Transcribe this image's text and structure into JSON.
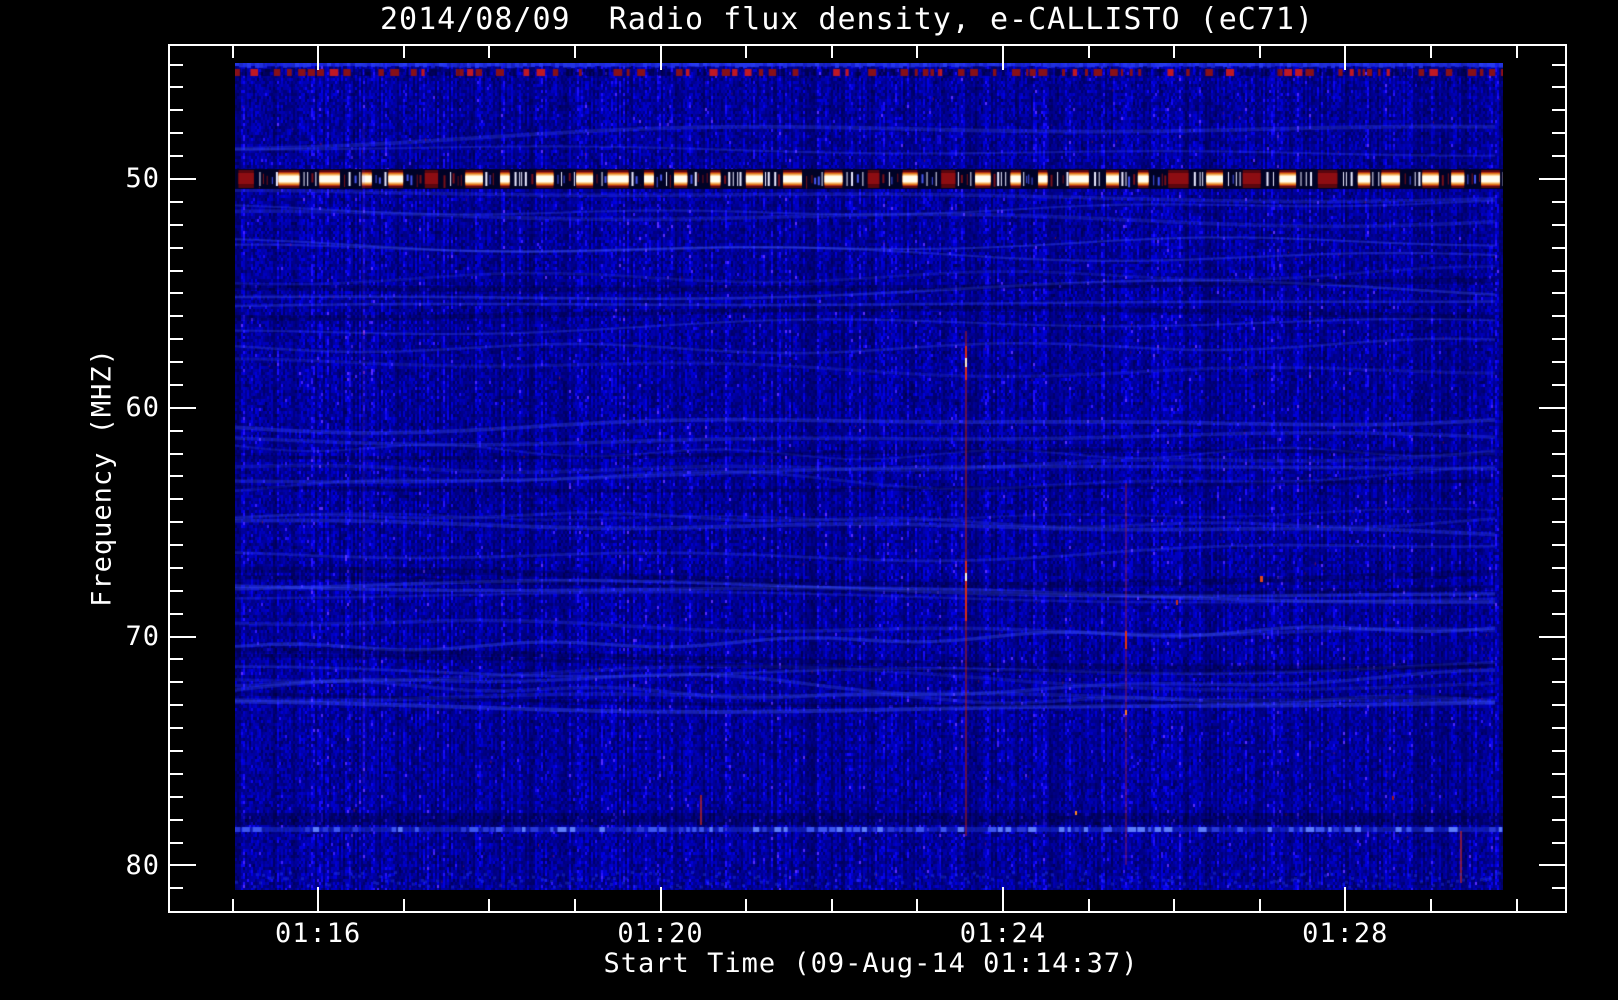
{
  "chart": {
    "title": "2014/08/09  Radio flux density, e-CALLISTO (eC71)",
    "x_axis": {
      "label": "Start Time (09-Aug-14 01:14:37)",
      "tick_labels": [
        "01:16",
        "01:20",
        "01:24",
        "01:28"
      ]
    },
    "y_axis": {
      "label": "Frequency (MHZ)",
      "tick_labels": [
        "50",
        "60",
        "70",
        "80"
      ]
    }
  },
  "chart_data": {
    "type": "heatmap",
    "subtype": "radio-spectrogram",
    "title": "2014/08/09  Radio flux density, e-CALLISTO (eC71)",
    "xlabel": "Start Time (09-Aug-14 01:14:37)",
    "ylabel": "Frequency (MHZ)",
    "x_ticks": [
      "01:16",
      "01:20",
      "01:24",
      "01:28"
    ],
    "x_minor_tick_interval": "1 min",
    "x_range_estimate": [
      "01:15:00",
      "01:29:55"
    ],
    "y_ticks": [
      50,
      60,
      70,
      80
    ],
    "y_minor_tick_interval_mhz": 1,
    "y_range_estimate_mhz": [
      45,
      81
    ],
    "y_axis_inverted": true,
    "grid": false,
    "legend": "none",
    "colormap": "dark blue noise background; strong signals map to red, orange and white",
    "features": [
      {
        "kind": "horizontal-rfi-band",
        "frequency_mhz": 50.3,
        "description": "strong intermittent RFI band: white/cream burst blocks with orange and dark-red fringes separated by dark gaps with thin dashes, spanning the whole time range"
      },
      {
        "kind": "horizontal-rfi-band",
        "frequency_mhz": 45.5,
        "description": "dashed dark-red interference line just below the top edge of the data"
      },
      {
        "kind": "horizontal-rfi-band",
        "frequency_mhz": 78.5,
        "description": "faint light-blue dashed horizontal line near the bottom"
      },
      {
        "kind": "vertical-rfi-streak",
        "time_estimate": "~01:23:30",
        "description": "narrow red vertical streak spanning ~52-80 MHz with saturated white points near 58 and 68 MHz"
      },
      {
        "kind": "vertical-rfi-streak",
        "time_estimate": "~01:25:25",
        "description": "fainter red vertical streak in the lower half with a bright red segment near 68 MHz"
      },
      {
        "kind": "point-rfi",
        "description": "scattered tiny red/orange dots across the spectrogram"
      },
      {
        "kind": "background",
        "description": "blue receiver noise with vertical striations and faint wavy light-blue ionospheric filaments mainly between ~52 and 65 MHz"
      }
    ]
  },
  "colors": {
    "background": "#000000",
    "frame": "#ffffff",
    "text": "#ffffff",
    "noise_base": "#0a0ac8",
    "rfi_core": "#fffdf0",
    "rfi_orange": "#e07818",
    "rfi_red": "#8b0a12"
  }
}
